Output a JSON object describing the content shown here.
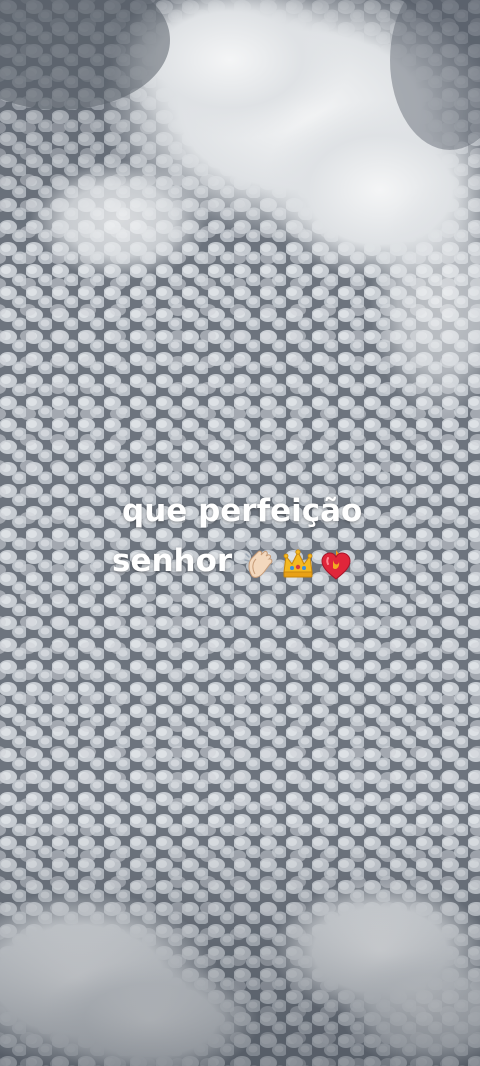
{
  "caption": {
    "line1": "que perfeição",
    "line2": "senhor"
  },
  "emojis": [
    "clapping-hands-icon",
    "crown-icon",
    "burning-heart-icon"
  ],
  "colors": {
    "sky_dark": "#5f6772",
    "cloud_light": "#e9ecef",
    "caption_text": "#ffffff"
  }
}
